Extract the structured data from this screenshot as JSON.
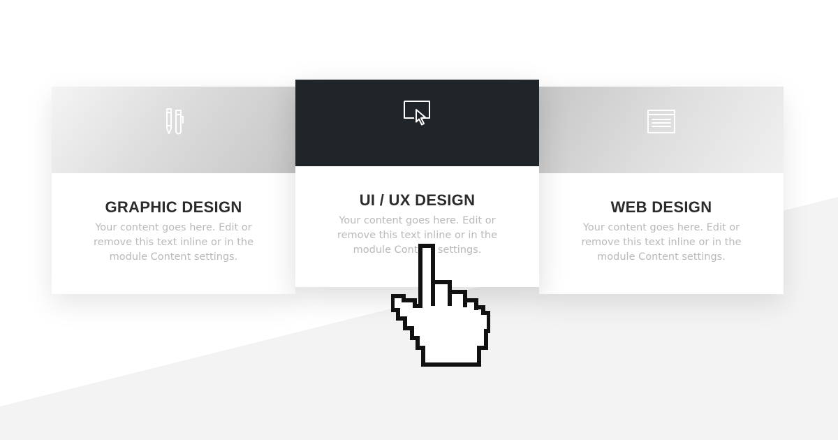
{
  "cards": [
    {
      "title": "GRAPHIC DESIGN",
      "text": "Your content goes here. Edit or remove this text inline or in the module Content settings.",
      "icon": "pens-icon"
    },
    {
      "title": "UI / UX DESIGN",
      "text": "Your content goes here. Edit or remove this text inline or in the module Content settings.",
      "icon": "screen-cursor-icon",
      "highlighted": true
    },
    {
      "title": "WEB DESIGN",
      "text": "Your content goes here. Edit or remove this text inline or in the module Content settings.",
      "icon": "browser-window-icon"
    }
  ],
  "cursor": {
    "icon": "hand-pointer-icon"
  },
  "colors": {
    "dark_header": "#1f2529",
    "title": "#2b2b2b",
    "body_text": "#b9b9b9",
    "background": "#ffffff",
    "background_shape": "#f3f3f3"
  }
}
